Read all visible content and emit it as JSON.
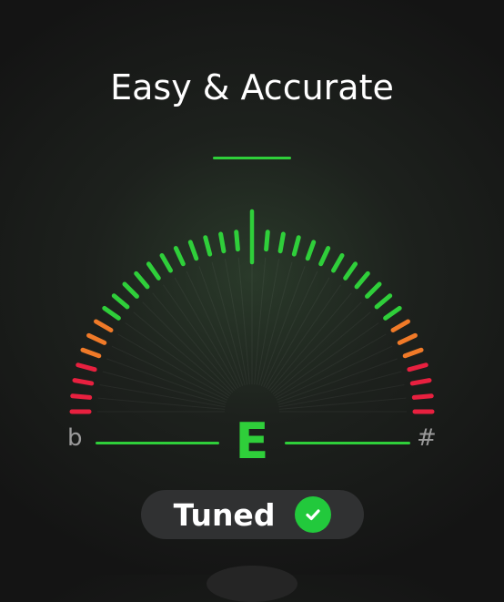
{
  "header": {
    "title": "Easy & Accurate"
  },
  "tuner": {
    "note": "E",
    "flat_symbol": "b",
    "sharp_symbol": "#",
    "deviation_cents": 0,
    "status": "Tuned"
  },
  "colors": {
    "in_tune": "#2fcf3a",
    "near": "#f07a28",
    "far": "#e8203f",
    "needle": "#ffffff",
    "check_badge": "#22c93c"
  },
  "icons": {
    "status": "check-circle-icon"
  }
}
